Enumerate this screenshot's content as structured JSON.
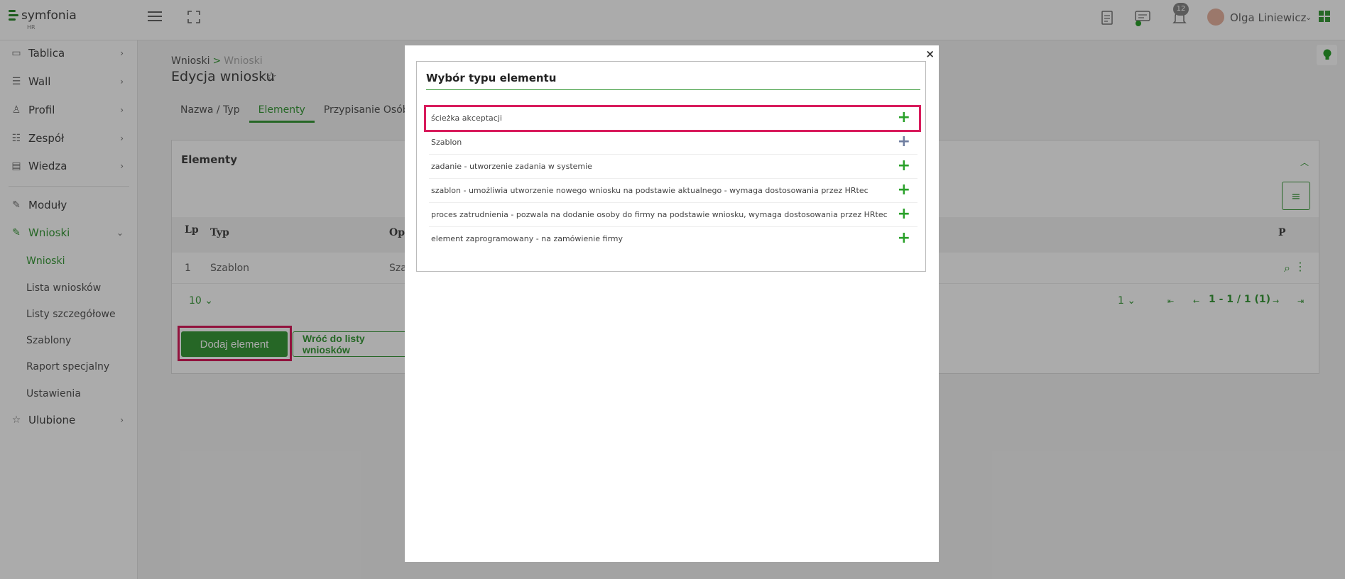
{
  "app": {
    "logo": "symfonia",
    "logo_sub": "HR"
  },
  "header": {
    "notifications_count": "12",
    "user_name": "Olga Liniewicz"
  },
  "sidebar": {
    "items": [
      {
        "label": "Tablica",
        "icon": "monitor-icon"
      },
      {
        "label": "Wall",
        "icon": "wall-icon"
      },
      {
        "label": "Profil",
        "icon": "user-icon"
      },
      {
        "label": "Zespół",
        "icon": "team-icon"
      },
      {
        "label": "Wiedza",
        "icon": "book-icon"
      },
      {
        "label": "Moduły",
        "icon": "wrench-icon"
      },
      {
        "label": "Wnioski",
        "icon": "wrench-icon"
      },
      {
        "label": "Ulubione",
        "icon": "star-icon"
      }
    ],
    "subitems": [
      "Wnioski",
      "Lista wniosków",
      "Listy szczegółowe",
      "Szablony",
      "Raport specjalny",
      "Ustawienia"
    ]
  },
  "breadcrumb": {
    "root": "Wnioski",
    "sep": ">",
    "current": "Wnioski"
  },
  "page": {
    "title": "Edycja wniosku"
  },
  "tabs": [
    "Nazwa / Typ",
    "Elementy",
    "Przypisanie Osób"
  ],
  "card": {
    "title": "Elementy",
    "columns": {
      "lp": "Lp",
      "typ": "Typ",
      "opis": "Opi",
      "p": "P"
    },
    "rows": [
      {
        "lp": "1",
        "typ": "Szablon",
        "opis": "Sza"
      }
    ],
    "page_size": "10",
    "page": "1",
    "page_info": "1 - 1 / 1 (1)"
  },
  "buttons": {
    "add": "Dodaj element",
    "back": "Wróć do listy wniosków"
  },
  "modal": {
    "title": "Wybór typu elementu",
    "close": "×",
    "options": [
      "ścieżka akceptacji",
      "Szablon",
      "zadanie - utworzenie zadania w systemie",
      "szablon - umożliwia utworzenie nowego wniosku na podstawie aktualnego - wymaga dostosowania przez HRtec",
      "proces zatrudnienia - pozwala na dodanie osoby do firmy na podstawie wniosku, wymaga dostosowania przez HRtec",
      "element zaprogramowany - na zamówienie firmy"
    ]
  },
  "colors": {
    "accent": "#3a9a3a",
    "highlight": "#d81b5c",
    "overlay": "rgba(0,0,0,0.33)"
  }
}
